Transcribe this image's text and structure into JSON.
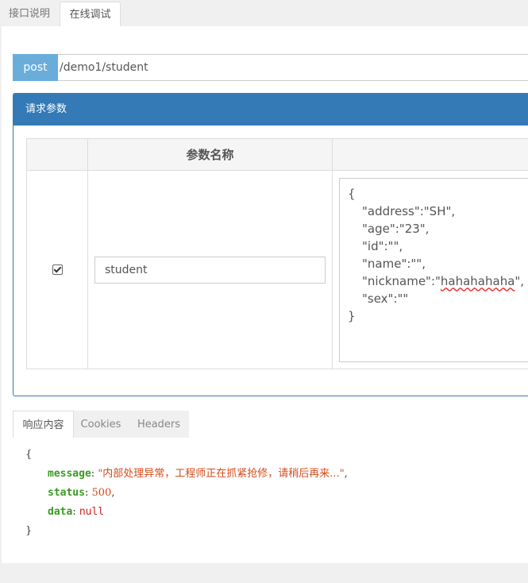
{
  "top_tabs": [
    {
      "label": "接口说明",
      "active": false
    },
    {
      "label": "在线调试",
      "active": true
    }
  ],
  "request": {
    "method": "post",
    "url": "/demo1/student"
  },
  "params": {
    "header": "请求参数",
    "columns": [
      "",
      "参数名称",
      ""
    ],
    "row": {
      "checked": true,
      "name_value": "student",
      "json_lines": [
        "{",
        "\"address\":\"SH\",",
        "\"age\":\"23\",",
        "\"id\":\"\",",
        "\"name\":\"\",",
        "\"nickname\":\"",
        "hahahahaha",
        "\",",
        "\"sex\":\"\"",
        "}"
      ]
    }
  },
  "response_tabs": [
    {
      "label": "响应内容",
      "active": true
    },
    {
      "label": "Cookies",
      "active": false
    },
    {
      "label": "Headers",
      "active": false
    }
  ],
  "response": {
    "open": "{",
    "close": "}",
    "fields": [
      {
        "key": "message",
        "value": "\"内部处理异常，工程师正在抓紧抢修，请稍后再来...\"",
        "suffix": ","
      },
      {
        "key": "status",
        "value": "500",
        "suffix": ","
      },
      {
        "key": "data",
        "value": "null",
        "suffix": ""
      }
    ]
  },
  "colors": {
    "method_badge": "#6aaddb",
    "panel_header": "#337ab7",
    "json_key": "#3a9a21",
    "json_string": "#d64b1a"
  }
}
